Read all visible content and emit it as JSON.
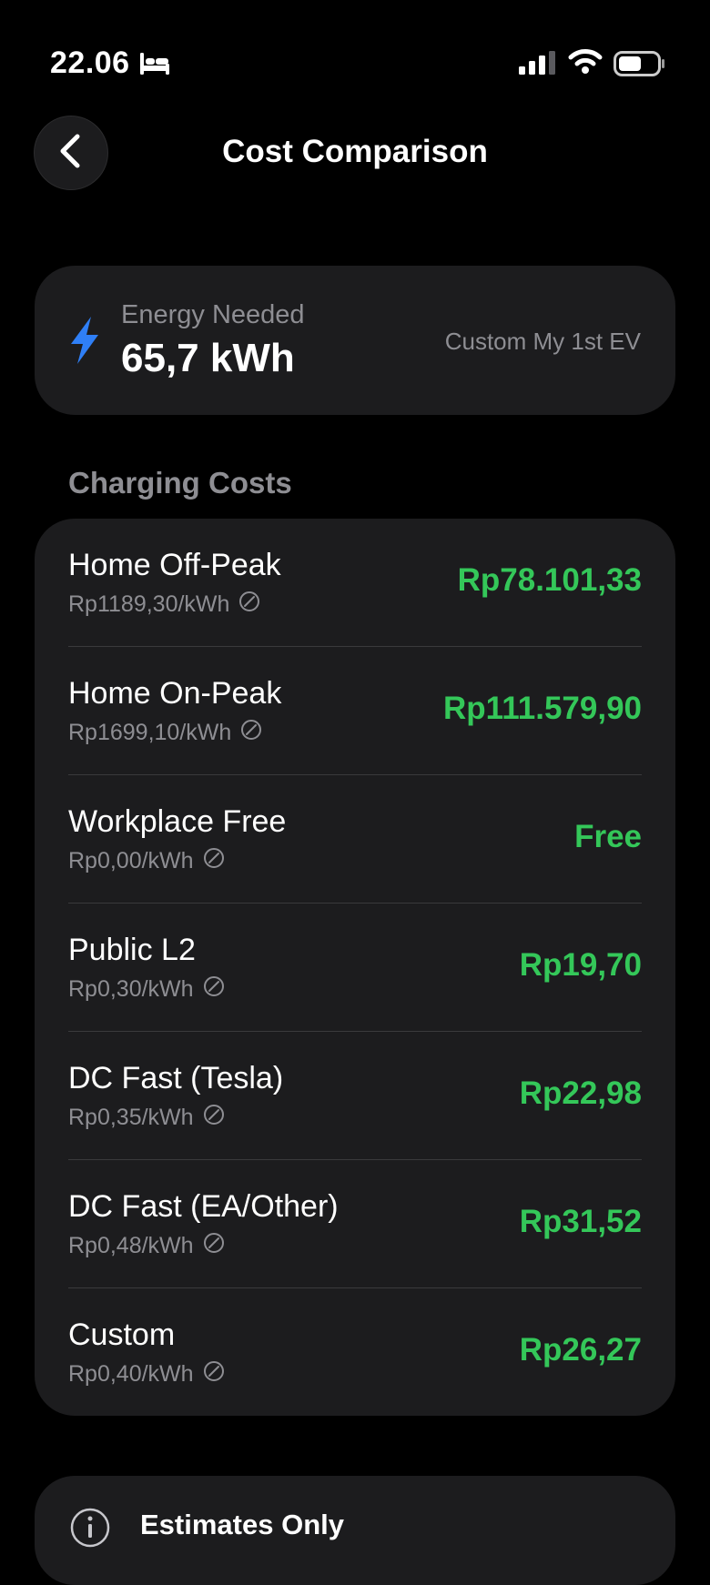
{
  "status_bar": {
    "time": "22.06"
  },
  "nav": {
    "title": "Cost Comparison"
  },
  "energy": {
    "label": "Energy Needed",
    "value": "65,7 kWh",
    "vehicle": "Custom My 1st EV"
  },
  "section": {
    "title": "Charging Costs"
  },
  "costs": [
    {
      "name": "Home Off-Peak",
      "rate": "Rp1189,30/kWh",
      "total": "Rp78.101,33"
    },
    {
      "name": "Home On-Peak",
      "rate": "Rp1699,10/kWh",
      "total": "Rp111.579,90"
    },
    {
      "name": "Workplace Free",
      "rate": "Rp0,00/kWh",
      "total": "Free"
    },
    {
      "name": "Public L2",
      "rate": "Rp0,30/kWh",
      "total": "Rp19,70"
    },
    {
      "name": "DC Fast (Tesla)",
      "rate": "Rp0,35/kWh",
      "total": "Rp22,98"
    },
    {
      "name": "DC Fast (EA/Other)",
      "rate": "Rp0,48/kWh",
      "total": "Rp31,52"
    },
    {
      "name": "Custom",
      "rate": "Rp0,40/kWh",
      "total": "Rp26,27"
    }
  ],
  "info": {
    "title": "Estimates Only"
  },
  "colors": {
    "accent_green": "#34c759",
    "bolt_blue": "#2f7ff6",
    "card_bg": "#1c1c1e",
    "secondary_text": "#8e8e93"
  },
  "icons": {
    "back": "chevron-left-icon",
    "bolt": "bolt-icon",
    "rate": "slash-circle-icon",
    "info": "info-circle-icon"
  }
}
